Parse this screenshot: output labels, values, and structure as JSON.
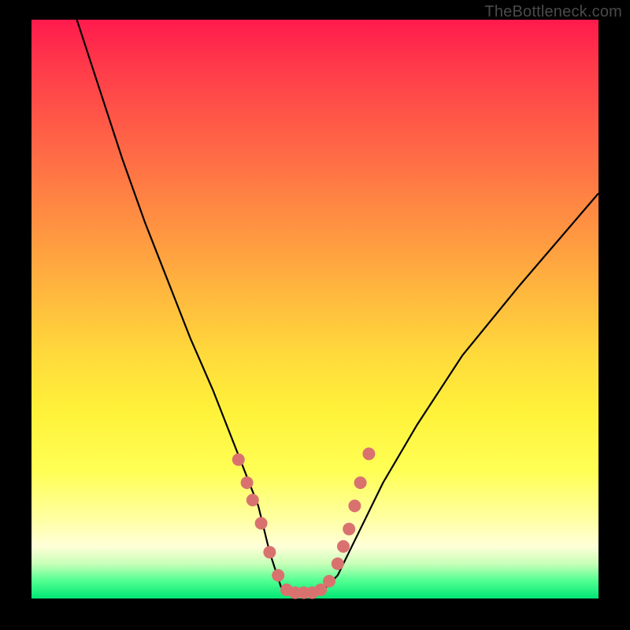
{
  "watermark": "TheBottleneck.com",
  "colors": {
    "frame": "#000000",
    "curve": "#000000",
    "dots": "#d9726f",
    "gradient_stops": [
      "#ff1a4d",
      "#ff3a4a",
      "#ff5a47",
      "#ff7a44",
      "#ff9a41",
      "#ffba3e",
      "#ffda3b",
      "#fff23a",
      "#ffff55",
      "#ffffa0",
      "#ffffd8",
      "#c8ffb8",
      "#50ff90",
      "#00e676"
    ]
  },
  "chart_data": {
    "type": "line",
    "title": "",
    "xlabel": "",
    "ylabel": "",
    "xlim": [
      0,
      100
    ],
    "ylim": [
      0,
      100
    ],
    "series": [
      {
        "name": "bottleneck-curve",
        "x": [
          8,
          12,
          16,
          20,
          24,
          28,
          32,
          34,
          36,
          38,
          40,
          41,
          42,
          43,
          44,
          45,
          46,
          48,
          50,
          52,
          54,
          56,
          58,
          62,
          68,
          76,
          86,
          100
        ],
        "y": [
          100,
          88,
          76,
          65,
          55,
          45,
          36,
          31,
          26,
          21,
          16,
          12,
          8,
          5,
          2,
          1,
          1,
          1,
          1,
          2,
          4,
          8,
          12,
          20,
          30,
          42,
          54,
          70
        ]
      }
    ],
    "points": {
      "name": "highlight-dots",
      "x": [
        36.5,
        38.0,
        39.0,
        40.5,
        42.0,
        43.5,
        45.0,
        46.5,
        48.0,
        49.5,
        51.0,
        52.5,
        54.0,
        55.0,
        56.0,
        57.0,
        58.0,
        59.5
      ],
      "y": [
        24.0,
        20.0,
        17.0,
        13.0,
        8.0,
        4.0,
        1.5,
        1.0,
        1.0,
        1.0,
        1.5,
        3.0,
        6.0,
        9.0,
        12.0,
        16.0,
        20.0,
        25.0
      ]
    }
  }
}
